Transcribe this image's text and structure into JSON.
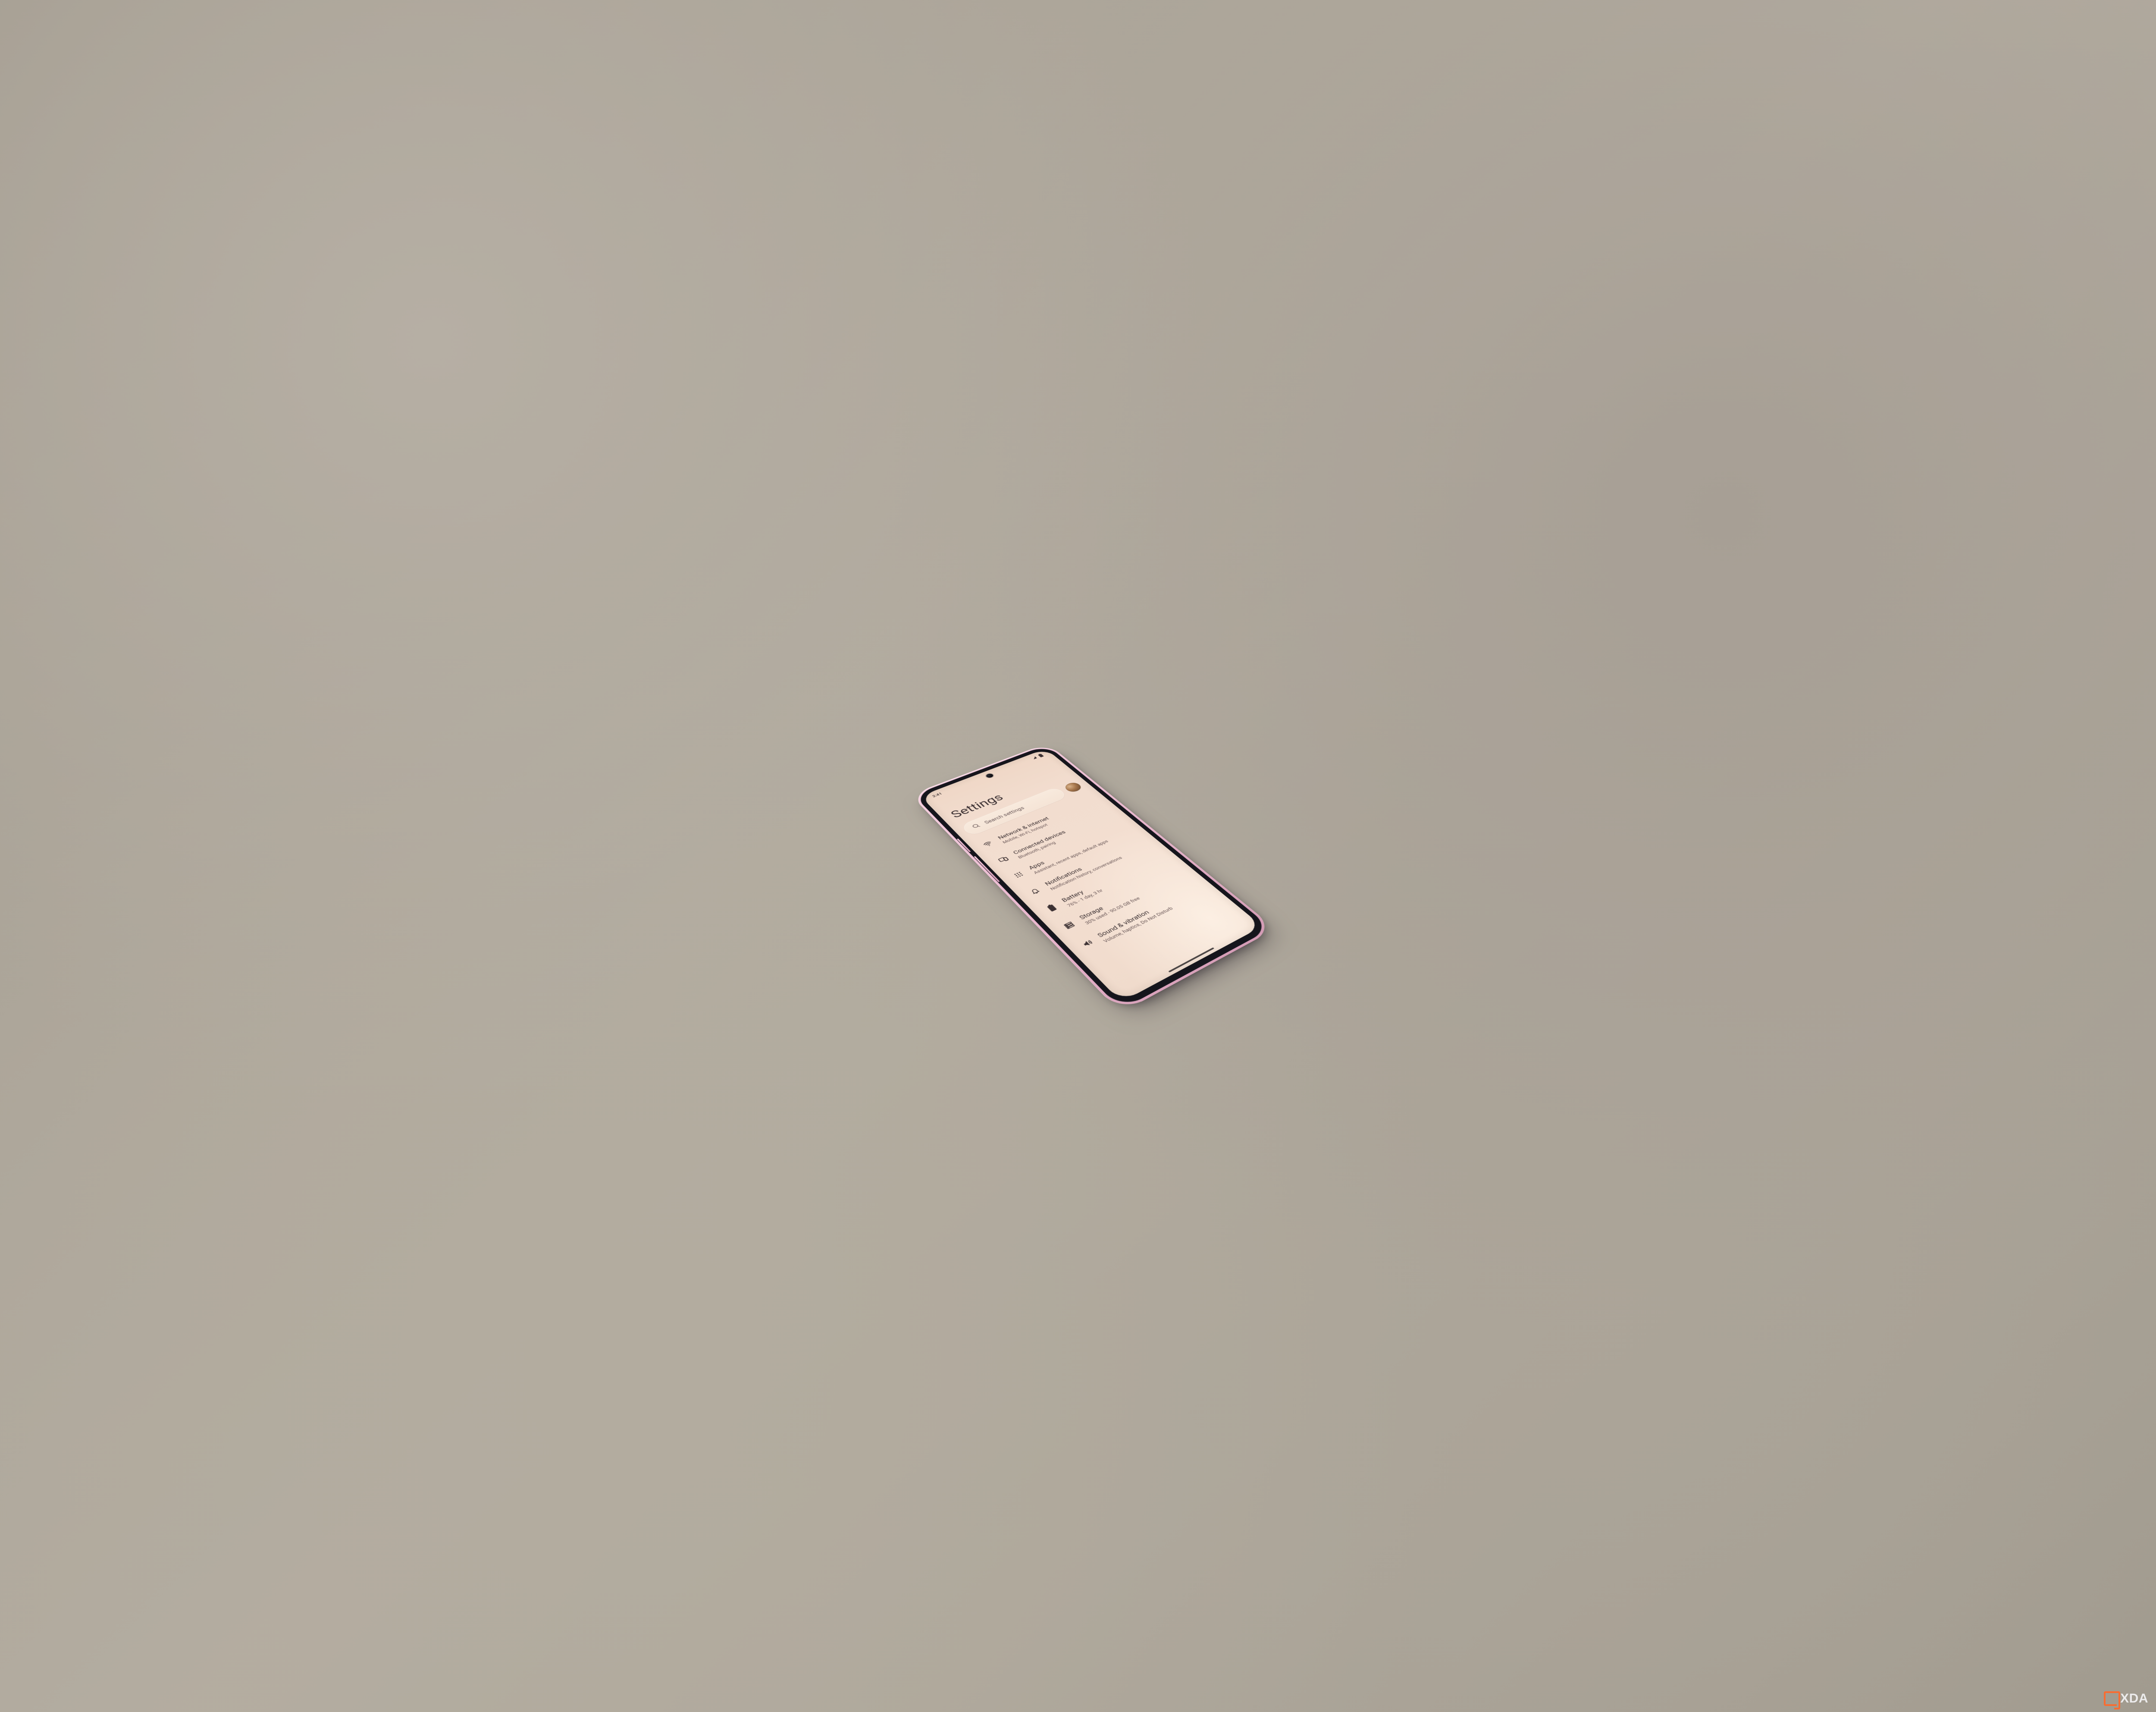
{
  "status_bar": {
    "time": "2:41",
    "signal_icon": "signal-cellular",
    "battery_icon": "battery"
  },
  "header": {
    "title": "Settings"
  },
  "search": {
    "placeholder": "Search settings",
    "icon": "search"
  },
  "avatar": {
    "label": "profile-avatar"
  },
  "items": [
    {
      "icon": "wifi",
      "title": "Network & internet",
      "subtitle": "Mobile, Wi-Fi, hotspot"
    },
    {
      "icon": "devices",
      "title": "Connected devices",
      "subtitle": "Bluetooth, pairing"
    },
    {
      "icon": "apps",
      "title": "Apps",
      "subtitle": "Assistant, recent apps, default apps"
    },
    {
      "icon": "bell",
      "title": "Notifications",
      "subtitle": "Notification history, conversations"
    },
    {
      "icon": "battery",
      "title": "Battery",
      "subtitle": "76% - 1 day, 3 hr"
    },
    {
      "icon": "storage",
      "title": "Storage",
      "subtitle": "30% used - 90.05 GB free"
    },
    {
      "icon": "volume",
      "title": "Sound & vibration",
      "subtitle": "Volume, haptics, Do Not Disturb"
    }
  ],
  "watermark": {
    "text": "XDA"
  }
}
